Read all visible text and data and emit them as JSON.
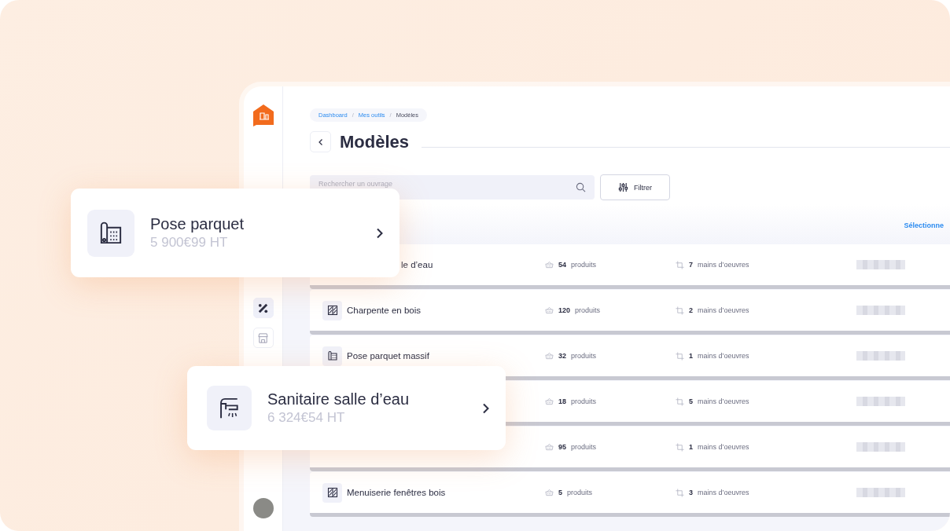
{
  "breadcrumb": [
    {
      "label": "Dashboard",
      "kind": "link"
    },
    {
      "label": "Mes outils",
      "kind": "link",
      "separator": "/"
    },
    {
      "label": "Modèles",
      "kind": "current",
      "separator": "/"
    }
  ],
  "title": "Modèles",
  "search": {
    "placeholder": "Rechercher un ouvrage"
  },
  "filter_button": "Filtrer",
  "select_link": "Sélectionne",
  "sidebar": {
    "items": [
      {
        "kind": "tools",
        "selected": true
      },
      {
        "kind": "store",
        "selected": false
      }
    ]
  },
  "rows": [
    {
      "kind": "clipped",
      "name": "le d’eau",
      "products_count": "54",
      "products_label": "produits",
      "labor_count": "7",
      "labor_label": "mains d’oeuvres"
    },
    {
      "kind": "frame",
      "name": "Charpente en bois",
      "products_count": "120",
      "products_label": "produits",
      "labor_count": "2",
      "labor_label": "mains d’oeuvres"
    },
    {
      "kind": "floor",
      "name": "Pose parquet massif",
      "products_count": "32",
      "products_label": "produits",
      "labor_count": "1",
      "labor_label": "mains d’oeuvres"
    },
    {
      "kind": "hidden",
      "products_count": "18",
      "products_label": "produits",
      "labor_count": "5",
      "labor_label": "mains d’oeuvres"
    },
    {
      "kind": "hidden",
      "products_count": "95",
      "products_label": "produits",
      "labor_count": "1",
      "labor_label": "mains d’oeuvres"
    },
    {
      "kind": "frame",
      "name": "Menuiserie fenêtres bois",
      "products_count": "5",
      "products_label": "produits",
      "labor_count": "3",
      "labor_label": "mains d’oeuvres"
    }
  ],
  "cards": [
    {
      "kind": "floor",
      "title": "Pose parquet",
      "price": "5 900€99 HT"
    },
    {
      "kind": "faucet",
      "title": "Sanitaire salle d’eau",
      "price": "6 324€54 HT"
    }
  ]
}
